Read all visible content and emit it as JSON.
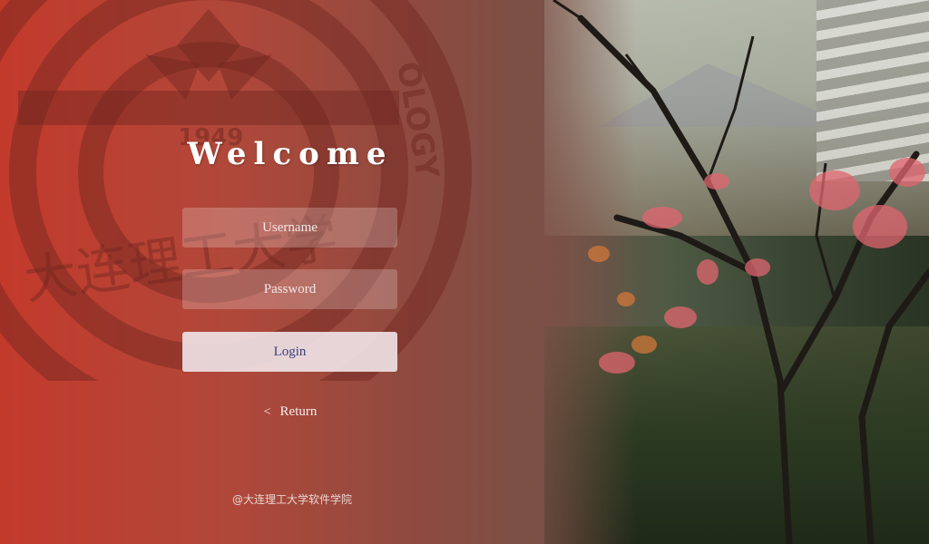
{
  "login": {
    "title": "Welcome",
    "username_placeholder": "Username",
    "password_placeholder": "Password",
    "login_label": "Login",
    "return_label": "Return",
    "return_icon": "chevron-left-icon"
  },
  "background": {
    "seal_text_top": "OLOGY",
    "seal_year": "1949",
    "seal_chinese": "大连理工大学"
  },
  "footer": {
    "copyright": "@大连理工大学软件学院"
  },
  "colors": {
    "accent_left": "#c33a2b",
    "photo_dark": "#2a3424",
    "login_text": "#3a3f7a"
  }
}
